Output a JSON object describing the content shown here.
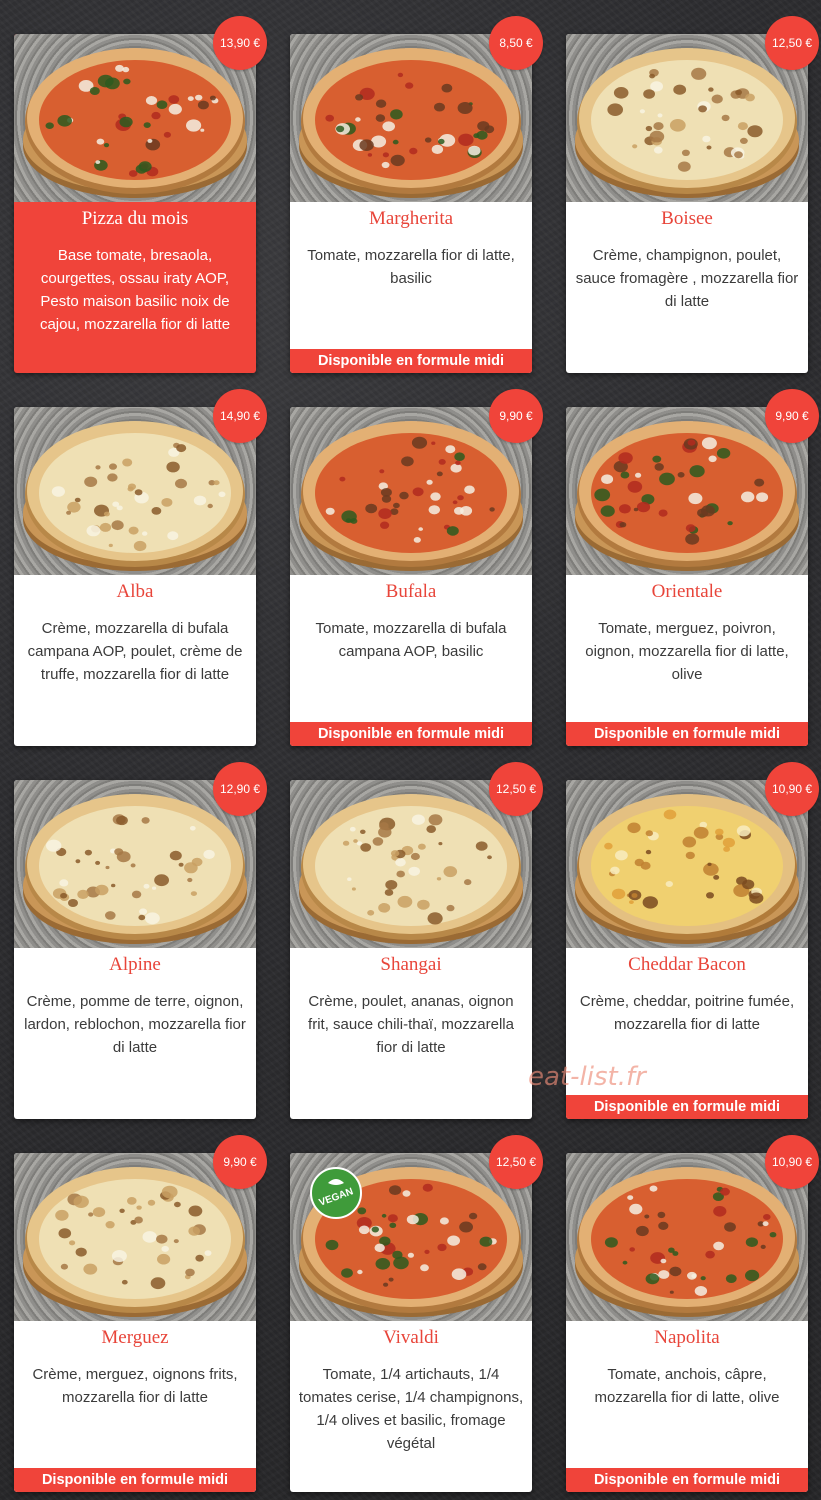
{
  "watermark": "eat-list.fr",
  "colors": {
    "accent": "#f0443a",
    "background": "#2d2d30",
    "card": "#ffffff",
    "title": "#e8453a",
    "text": "#3b3b3b"
  },
  "formule_label": "Disponible en formule midi",
  "pizzas": [
    {
      "name": "Pizza du mois",
      "price": "13,90 €",
      "description": "Base tomate, bresaola, courgettes, ossau iraty AOP, Pesto maison basilic noix de cajou, mozzarella fior di latte",
      "featured": true,
      "formule": false,
      "base": "tomato"
    },
    {
      "name": "Margherita",
      "price": "8,50 €",
      "description": "Tomate, mozzarella fior di latte, basilic",
      "featured": false,
      "formule": true,
      "base": "tomato"
    },
    {
      "name": "Boisee",
      "price": "12,50 €",
      "description": "Crème, champignon, poulet, sauce fromagère , mozzarella fior di latte",
      "featured": false,
      "formule": false,
      "base": "cream"
    },
    {
      "name": "Alba",
      "price": "14,90 €",
      "description": "Crème, mozzarella di bufala campana AOP, poulet, crème de truffe, mozzarella fior di latte",
      "featured": false,
      "formule": false,
      "base": "cream"
    },
    {
      "name": "Bufala",
      "price": "9,90 €",
      "description": "Tomate, mozzarella di bufala campana AOP, basilic",
      "featured": false,
      "formule": true,
      "base": "tomato"
    },
    {
      "name": "Orientale",
      "price": "9,90 €",
      "description": "Tomate, merguez, poivron, oignon, mozzarella fior di latte, olive",
      "featured": false,
      "formule": true,
      "base": "tomato"
    },
    {
      "name": "Alpine",
      "price": "12,90 €",
      "description": "Crème, pomme de terre, oignon, lardon, reblochon, mozzarella fior di latte",
      "featured": false,
      "formule": false,
      "base": "cream"
    },
    {
      "name": "Shangai",
      "price": "12,50 €",
      "description": "Crème, poulet, ananas, oignon frit, sauce chili-thaï, mozzarella fior di latte",
      "featured": false,
      "formule": false,
      "base": "cream"
    },
    {
      "name": "Cheddar Bacon",
      "price": "10,90 €",
      "description": "Crème, cheddar, poitrine fumée, mozzarella fior di latte",
      "featured": false,
      "formule": true,
      "base": "cheddar"
    },
    {
      "name": "Merguez",
      "price": "9,90 €",
      "description": "Crème, merguez, oignons frits, mozzarella fior di latte",
      "featured": false,
      "formule": true,
      "base": "cream"
    },
    {
      "name": "Vivaldi",
      "price": "12,50 €",
      "description": "Tomate, 1/4 artichauts, 1/4 tomates cerise, 1/4 champignons, 1/4 olives et basilic, fromage végétal",
      "featured": false,
      "formule": false,
      "base": "tomato",
      "vegan_badge": "VEGAN"
    },
    {
      "name": "Napolita",
      "price": "10,90 €",
      "description": "Tomate, anchois, câpre, mozzarella fior di latte, olive",
      "featured": false,
      "formule": true,
      "base": "tomato"
    }
  ]
}
